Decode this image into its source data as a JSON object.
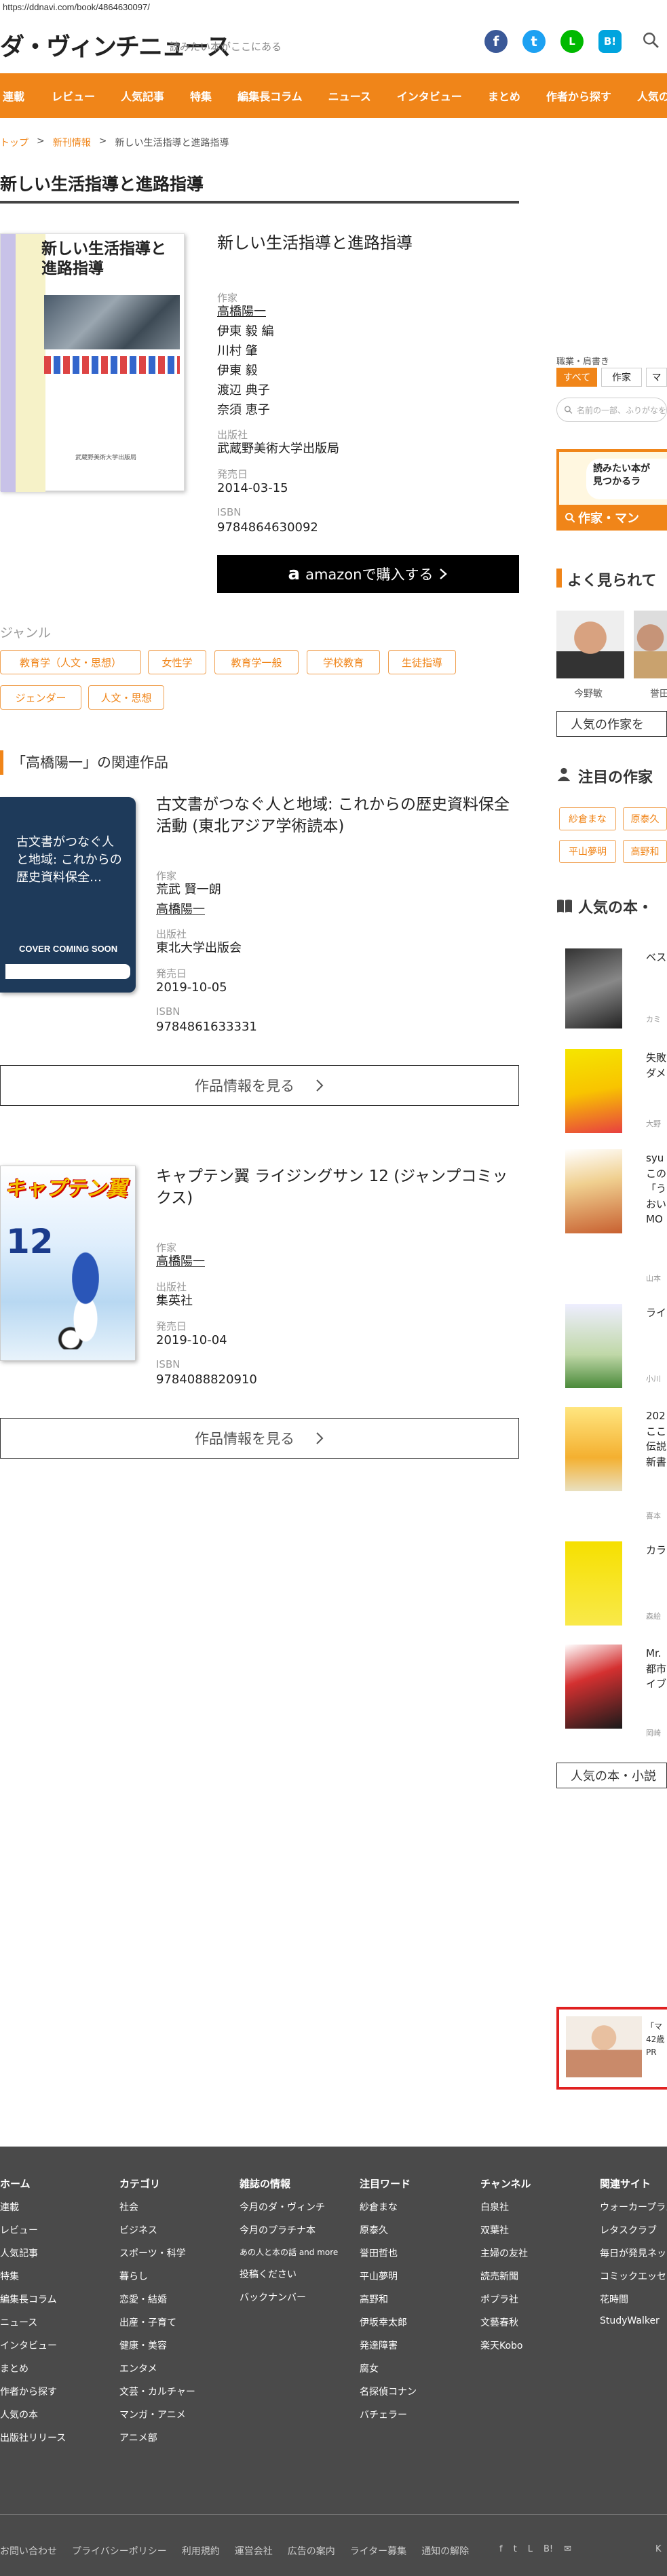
{
  "browser": {
    "url": "https://ddnavi.com/book/4864630097/"
  },
  "header": {
    "logo": "ダ・ヴィンチニュース",
    "tagline": "読みたい本がここにある",
    "social_labels": {
      "facebook": "f",
      "twitter": "t",
      "line": "L",
      "hatena": "B!"
    }
  },
  "nav": {
    "items": [
      "連載",
      "レビュー",
      "人気記事",
      "特集",
      "編集長コラム",
      "ニュース",
      "インタビュー",
      "まとめ",
      "作者から探す",
      "人気の本"
    ]
  },
  "breadcrumb": {
    "home": "トップ",
    "sep": ">",
    "category": "新刊情報",
    "current": "新しい生活指導と進路指導"
  },
  "page": {
    "title": "新しい生活指導と進路指導"
  },
  "book": {
    "title": "新しい生活指導と進路指導",
    "cover_title": "新しい生活指導と進路指導",
    "cover_publisher": "武蔵野美術大学出版局",
    "author_label": "作家",
    "authors": [
      "高橋陽一",
      "伊東 毅 編",
      "川村 肇",
      "伊東 毅",
      "渡辺 典子",
      "奈須 恵子"
    ],
    "publisher_label": "出版社",
    "publisher": "武蔵野美術大学出版局",
    "date_label": "発売日",
    "date": "2014-03-15",
    "isbn_label": "ISBN",
    "isbn": "9784864630092",
    "amazon_button": "amazonで購入する",
    "amazon_logo": "a"
  },
  "genre": {
    "heading": "ジャンル",
    "tags": [
      "教育学（人文・思想）",
      "女性学",
      "教育学一般",
      "学校教育",
      "生徒指導",
      "ジェンダー",
      "人文・思想"
    ]
  },
  "related": {
    "heading": "「高橋陽一」の関連作品",
    "items": [
      {
        "title": "古文書がつなぐ人と地域: これからの歴史資料保全活動 (東北アジア学術読本)",
        "cover_text": "古文書がつなぐ人と地域: これからの歴史資料保全…",
        "cover_badge": "COVER COMING SOON",
        "author_label": "作家",
        "authors": [
          "荒武 賢一朗",
          "高橋陽一"
        ],
        "publisher_label": "出版社",
        "publisher": "東北大学出版会",
        "date_label": "発売日",
        "date": "2019-10-05",
        "isbn_label": "ISBN",
        "isbn": "9784861633331",
        "button": "作品情報を見る"
      },
      {
        "title": "キャプテン翼 ライジングサン 12 (ジャンプコミックス)",
        "cover_text": "キャプテン翼",
        "cover_badge": "12",
        "author_label": "作家",
        "authors": [
          "高橋陽一"
        ],
        "publisher_label": "出版社",
        "publisher": "集英社",
        "date_label": "発売日",
        "date": "2019-10-04",
        "isbn_label": "ISBN",
        "isbn": "9784088820910",
        "button": "作品情報を見る"
      }
    ]
  },
  "sidebar": {
    "search_label": "職業・肩書き",
    "tabs": [
      "すべて",
      "作家",
      "マ"
    ],
    "search_placeholder": "名前の一部、ふりがなを",
    "banner_top": "読みたい本が",
    "banner_mid": "見つかるラ",
    "banner_bottom": "作家・マン",
    "popular_authors_heading": "よく見られて",
    "authors": [
      {
        "name": "今野敏"
      },
      {
        "name": "誉田"
      }
    ],
    "popular_authors_button": "人気の作家を",
    "featured_heading": "注目の作家",
    "featured_tags": [
      "紗倉まな",
      "原泰久",
      "平山夢明",
      "高野和"
    ],
    "popular_books_heading": "人気の本・",
    "ranking": [
      {
        "title": "ベス",
        "author": "カミ"
      },
      {
        "title": "失敗\nダメ",
        "author": "大野"
      },
      {
        "title": "syu\nこの\n「う\nおい\nMO",
        "author": "山本"
      },
      {
        "title": "ライ",
        "author": "小川"
      },
      {
        "title": "202\nここ\n伝説\n新書",
        "author": "喜本"
      },
      {
        "title": "カラ",
        "author": "森絵"
      },
      {
        "title": "Mr.\n都市\nイブ",
        "author": "岡崎"
      }
    ],
    "popular_books_button": "人気の本・小説",
    "ad_text": "「マ\n42歳\nPR"
  },
  "footer": {
    "columns": [
      {
        "title": "ホーム",
        "items": [
          "連載",
          "レビュー",
          "人気記事",
          "特集",
          "編集長コラム",
          "ニュース",
          "インタビュー",
          "まとめ",
          "作者から探す",
          "人気の本",
          "出版社リリース"
        ]
      },
      {
        "title": "カテゴリ",
        "items": [
          "社会",
          "ビジネス",
          "スポーツ・科学",
          "暮らし",
          "恋愛・結婚",
          "出産・子育て",
          "健康・美容",
          "エンタメ",
          "文芸・カルチャー",
          "マンガ・アニメ",
          "アニメ部"
        ]
      },
      {
        "title": "雑誌の情報",
        "items": [
          "今月のダ・ヴィンチ",
          "今月のプラチナ本",
          "あの人と本の話 and more",
          "投稿ください",
          "バックナンバー"
        ]
      },
      {
        "title": "注目ワード",
        "items": [
          "紗倉まな",
          "原泰久",
          "誉田哲也",
          "平山夢明",
          "高野和",
          "伊坂幸太郎",
          "発達障害",
          "腐女",
          "名探偵コナン",
          "バチェラー"
        ]
      },
      {
        "title": "チャンネル",
        "items": [
          "白泉社",
          "双葉社",
          "主婦の友社",
          "読売新聞",
          "ポプラ社",
          "文藝春秋",
          "楽天Kobo"
        ]
      },
      {
        "title": "関連サイト",
        "items": [
          "ウォーカープラス",
          "レタスクラブ",
          "毎日が発見ネット",
          "コミックエッセイ",
          "花時間",
          "StudyWalker"
        ]
      }
    ],
    "links": [
      "お問い合わせ",
      "プライバシーポリシー",
      "利用規約",
      "運営会社",
      "広告の案内",
      "ライター募集",
      "通知の解除"
    ],
    "social": [
      "f",
      "t",
      "L",
      "B!",
      "✉"
    ],
    "copyright": "K"
  }
}
